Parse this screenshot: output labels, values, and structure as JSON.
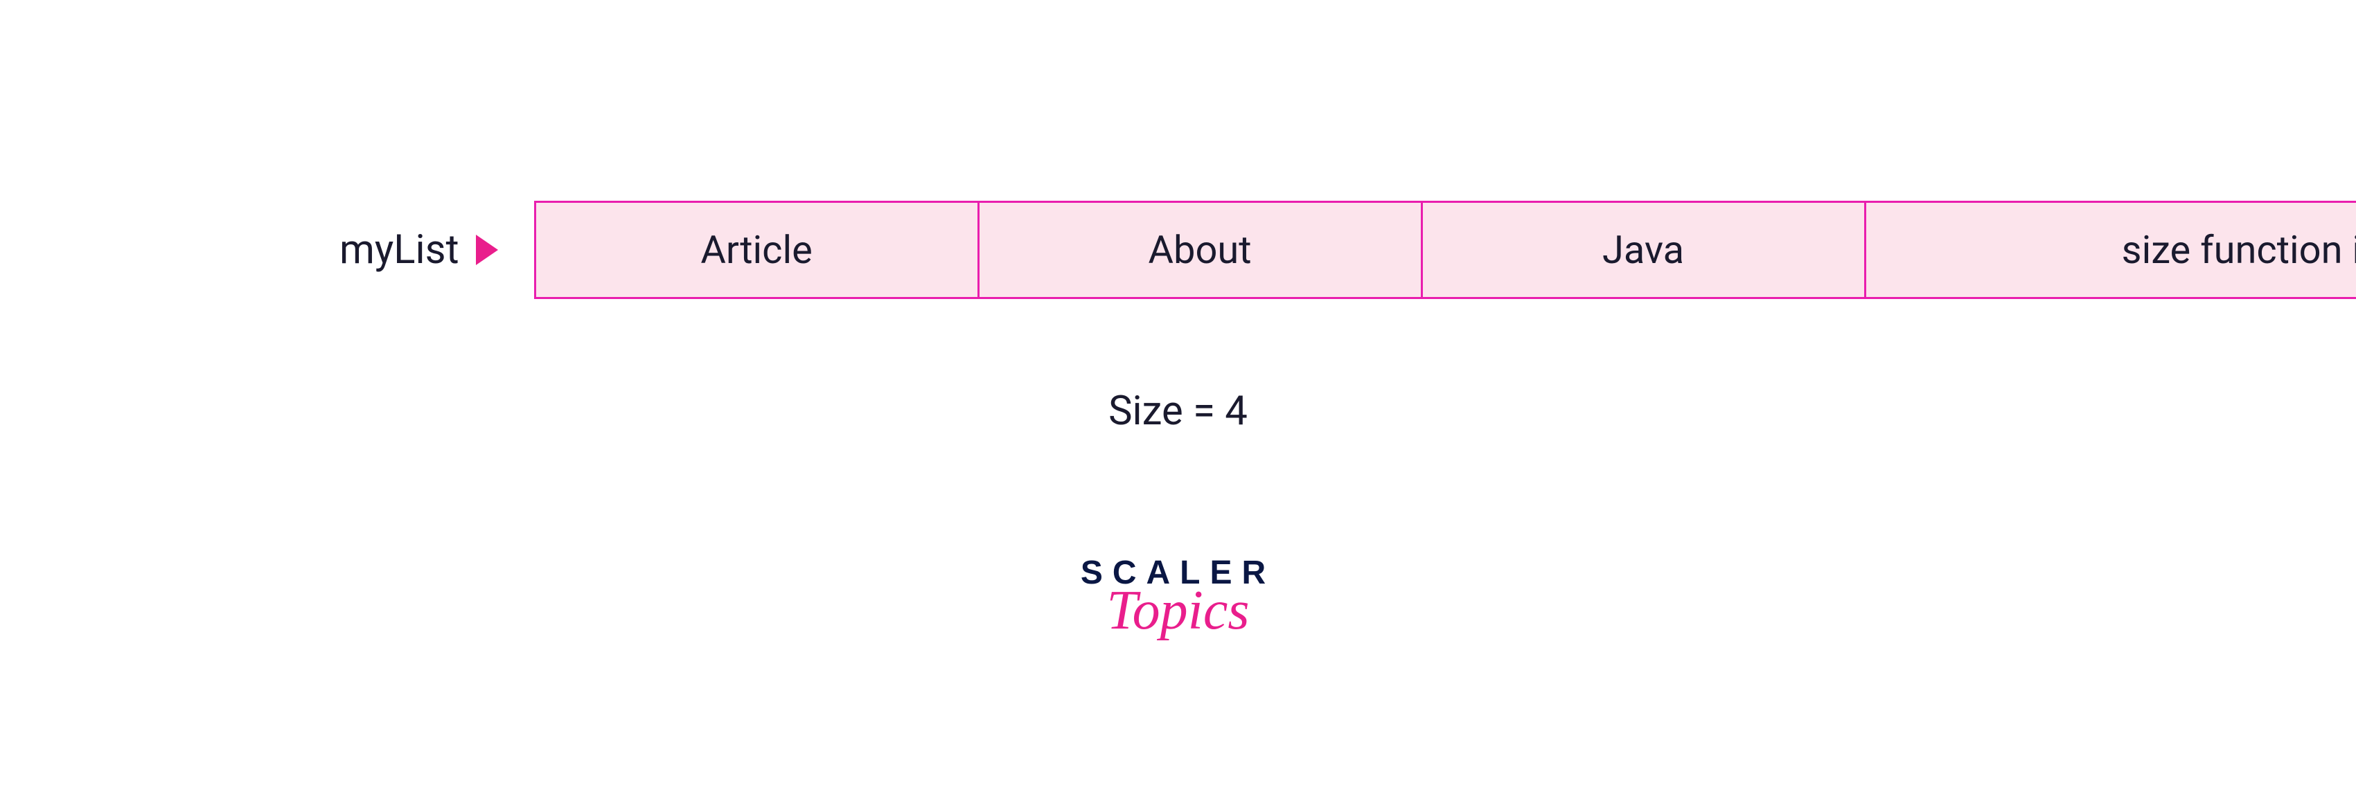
{
  "list": {
    "label": "myList",
    "items": [
      "Article",
      "About",
      "Java",
      "size function in java"
    ]
  },
  "size_text": "Size = 4",
  "logo": {
    "line1": "SCALER",
    "line2": "Topics"
  }
}
